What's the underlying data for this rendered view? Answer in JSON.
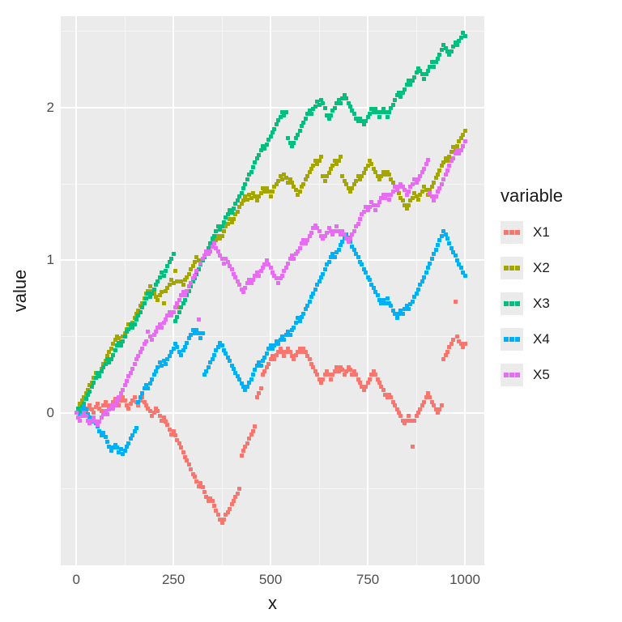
{
  "axis": {
    "x_title": "x",
    "y_title": "value"
  },
  "legend": {
    "title": "variable",
    "items": [
      {
        "label": "X1",
        "color": "#F8766D"
      },
      {
        "label": "X2",
        "color": "#A3A500"
      },
      {
        "label": "X3",
        "color": "#00BF7D"
      },
      {
        "label": "X4",
        "color": "#00B0F6"
      },
      {
        "label": "X5",
        "color": "#E76BF3"
      }
    ]
  },
  "x_ticks": [
    0,
    250,
    500,
    750,
    1000
  ],
  "y_ticks": [
    0,
    1,
    2
  ],
  "chart_data": {
    "type": "scatter",
    "xlabel": "x",
    "ylabel": "value",
    "xlim": [
      -40,
      1050
    ],
    "ylim": [
      -1.0,
      2.6
    ],
    "grid": true,
    "legend_position": "right",
    "x_step": 5,
    "series": [
      {
        "name": "X1",
        "color": "#F8766D",
        "values": [
          0.0,
          0.02,
          0.04,
          0.01,
          -0.02,
          0.0,
          0.03,
          0.05,
          0.02,
          0.0,
          0.04,
          0.06,
          0.03,
          0.01,
          0.05,
          0.07,
          0.05,
          0.02,
          0.04,
          0.07,
          0.09,
          0.07,
          0.05,
          0.08,
          0.1,
          0.08,
          0.05,
          0.03,
          0.06,
          0.08,
          0.1,
          0.07,
          0.05,
          0.08,
          0.1,
          0.07,
          0.05,
          0.03,
          0.01,
          -0.02,
          0.0,
          0.03,
          0.01,
          -0.02,
          -0.05,
          -0.03,
          -0.06,
          -0.08,
          -0.11,
          -0.14,
          -0.12,
          -0.15,
          -0.18,
          -0.2,
          -0.23,
          -0.26,
          -0.29,
          -0.31,
          -0.34,
          -0.37,
          -0.4,
          -0.42,
          -0.45,
          -0.48,
          -0.46,
          -0.49,
          -0.52,
          -0.55,
          -0.58,
          -0.56,
          -0.58,
          -0.61,
          -0.64,
          -0.67,
          -0.7,
          -0.72,
          -0.7,
          -0.67,
          -0.65,
          -0.63,
          -0.6,
          -0.58,
          -0.55,
          -0.53,
          -0.5,
          -0.28,
          -0.25,
          -0.22,
          -0.2,
          -0.17,
          -0.14,
          -0.12,
          -0.09,
          0.1,
          0.13,
          0.16,
          0.25,
          0.27,
          0.3,
          0.32,
          0.35,
          0.37,
          0.35,
          0.38,
          0.4,
          0.42,
          0.4,
          0.37,
          0.4,
          0.42,
          0.4,
          0.37,
          0.35,
          0.38,
          0.4,
          0.42,
          0.4,
          0.42,
          0.4,
          0.37,
          0.35,
          0.32,
          0.3,
          0.27,
          0.25,
          0.22,
          0.2,
          0.22,
          0.25,
          0.27,
          0.25,
          0.22,
          0.25,
          0.27,
          0.3,
          0.27,
          0.3,
          0.28,
          0.25,
          0.27,
          0.3,
          0.28,
          0.25,
          0.27,
          0.25,
          0.22,
          0.2,
          0.17,
          0.15,
          0.17,
          0.2,
          0.22,
          0.25,
          0.27,
          0.25,
          0.22,
          0.2,
          0.17,
          0.15,
          0.12,
          0.1,
          0.12,
          0.1,
          0.07,
          0.05,
          0.02,
          0.0,
          -0.02,
          -0.05,
          -0.07,
          -0.05,
          -0.02,
          -0.05,
          -0.22,
          -0.05,
          -0.02,
          0.0,
          0.02,
          0.05,
          0.07,
          0.1,
          0.13,
          0.1,
          0.07,
          0.05,
          0.02,
          0.0,
          0.02,
          0.05,
          0.35,
          0.38,
          0.4,
          0.43,
          0.45,
          0.48,
          0.73,
          0.5,
          0.47,
          0.45,
          0.43,
          0.45
        ]
      },
      {
        "name": "X2",
        "color": "#A3A500",
        "values": [
          0.0,
          0.03,
          0.06,
          0.08,
          0.1,
          0.13,
          0.15,
          0.18,
          0.2,
          0.23,
          0.26,
          0.24,
          0.26,
          0.29,
          0.32,
          0.34,
          0.37,
          0.4,
          0.42,
          0.45,
          0.48,
          0.5,
          0.49,
          0.47,
          0.5,
          0.52,
          0.55,
          0.58,
          0.56,
          0.59,
          0.62,
          0.65,
          0.67,
          0.7,
          0.72,
          0.75,
          0.78,
          0.8,
          0.83,
          0.8,
          0.78,
          0.76,
          0.74,
          0.77,
          0.79,
          0.72,
          0.8,
          0.82,
          0.84,
          0.87,
          0.85,
          0.93,
          0.86,
          0.69,
          0.86,
          0.84,
          0.87,
          0.89,
          0.91,
          0.94,
          0.96,
          0.99,
          1.02,
          1.0,
          0.97,
          1.0,
          1.02,
          1.05,
          1.07,
          1.1,
          1.12,
          1.15,
          1.13,
          1.16,
          1.14,
          1.16,
          1.19,
          1.22,
          1.24,
          1.27,
          1.25,
          1.27,
          1.3,
          1.32,
          1.35,
          1.37,
          1.39,
          1.42,
          1.4,
          1.43,
          1.41,
          1.44,
          1.42,
          1.39,
          1.42,
          1.44,
          1.47,
          1.45,
          1.47,
          1.45,
          1.42,
          1.45,
          1.48,
          1.5,
          1.52,
          1.55,
          1.53,
          1.56,
          1.54,
          1.51,
          1.53,
          1.51,
          1.48,
          1.46,
          1.43,
          1.45,
          1.48,
          1.5,
          1.53,
          1.55,
          1.58,
          1.6,
          1.62,
          1.65,
          1.63,
          1.65,
          1.68,
          1.55,
          1.52,
          1.55,
          1.57,
          1.6,
          1.62,
          1.65,
          1.63,
          1.65,
          1.68,
          1.55,
          1.52,
          1.5,
          1.47,
          1.45,
          1.47,
          1.5,
          1.52,
          1.55,
          1.53,
          1.55,
          1.57,
          1.6,
          1.62,
          1.65,
          1.63,
          1.6,
          1.58,
          1.55,
          1.53,
          1.55,
          1.58,
          1.56,
          1.58,
          1.56,
          1.53,
          1.51,
          1.48,
          1.46,
          1.44,
          1.41,
          1.39,
          1.36,
          1.34,
          1.36,
          1.39,
          1.41,
          1.44,
          1.42,
          1.4,
          1.43,
          1.45,
          1.48,
          1.46,
          1.43,
          1.46,
          1.48,
          1.51,
          1.54,
          1.56,
          1.59,
          1.62,
          1.64,
          1.67,
          1.65,
          1.68,
          1.71,
          1.74,
          1.72,
          1.75,
          1.78,
          1.8,
          1.82,
          1.85
        ]
      },
      {
        "name": "X3",
        "color": "#00BF7D",
        "values": [
          0.0,
          0.03,
          0.01,
          0.04,
          0.06,
          0.09,
          0.12,
          0.14,
          0.17,
          0.2,
          0.23,
          0.26,
          0.24,
          0.27,
          0.3,
          0.32,
          0.35,
          0.33,
          0.35,
          0.38,
          0.41,
          0.44,
          0.46,
          0.44,
          0.47,
          0.5,
          0.53,
          0.55,
          0.58,
          0.56,
          0.58,
          0.61,
          0.64,
          0.66,
          0.69,
          0.72,
          0.75,
          0.78,
          0.76,
          0.78,
          0.81,
          0.84,
          0.86,
          0.89,
          0.92,
          0.9,
          0.93,
          0.96,
          0.99,
          1.01,
          1.04,
          0.6,
          0.63,
          0.66,
          0.69,
          0.72,
          0.74,
          0.77,
          0.8,
          0.83,
          0.86,
          0.88,
          0.91,
          0.94,
          0.97,
          1.0,
          1.02,
          1.05,
          1.08,
          1.11,
          1.14,
          1.16,
          1.19,
          1.22,
          1.2,
          1.22,
          1.25,
          1.28,
          1.3,
          1.33,
          1.31,
          1.34,
          1.37,
          1.39,
          1.42,
          1.44,
          1.47,
          1.5,
          1.53,
          1.56,
          1.58,
          1.61,
          1.64,
          1.67,
          1.69,
          1.72,
          1.75,
          1.73,
          1.76,
          1.79,
          1.81,
          1.84,
          1.86,
          1.89,
          1.92,
          1.94,
          1.97,
          1.95,
          1.97,
          1.8,
          1.77,
          1.75,
          1.77,
          1.8,
          1.82,
          1.85,
          1.88,
          1.9,
          1.93,
          1.96,
          1.98,
          1.96,
          1.99,
          2.01,
          2.04,
          2.02,
          2.05,
          2.03,
          2.0,
          1.95,
          1.93,
          1.95,
          1.98,
          2.0,
          2.03,
          2.05,
          2.03,
          2.06,
          2.08,
          2.06,
          2.03,
          2.01,
          1.98,
          1.96,
          1.93,
          1.91,
          1.93,
          1.91,
          1.89,
          1.91,
          1.94,
          1.96,
          1.99,
          1.97,
          1.99,
          1.97,
          1.94,
          1.97,
          1.99,
          1.97,
          1.94,
          1.97,
          2.0,
          2.02,
          2.05,
          2.08,
          2.1,
          2.07,
          2.1,
          2.12,
          2.15,
          2.18,
          2.15,
          2.18,
          2.2,
          2.23,
          2.26,
          2.24,
          2.22,
          2.19,
          2.22,
          2.24,
          2.27,
          2.3,
          2.27,
          2.3,
          2.32,
          2.35,
          2.38,
          2.41,
          2.39,
          2.37,
          2.35,
          2.37,
          2.4,
          2.43,
          2.41,
          2.44,
          2.46,
          2.49,
          2.47
        ]
      },
      {
        "name": "X4",
        "color": "#00B0F6",
        "values": [
          0.0,
          -0.03,
          -0.01,
          0.02,
          0.04,
          0.02,
          -0.01,
          -0.03,
          -0.06,
          -0.04,
          -0.07,
          -0.09,
          -0.12,
          -0.15,
          -0.13,
          -0.16,
          -0.19,
          -0.22,
          -0.25,
          -0.23,
          -0.21,
          -0.23,
          -0.26,
          -0.24,
          -0.27,
          -0.25,
          -0.22,
          -0.2,
          -0.17,
          -0.15,
          -0.12,
          -0.1,
          0.07,
          0.1,
          0.13,
          0.16,
          0.18,
          0.16,
          0.19,
          0.22,
          0.25,
          0.27,
          0.3,
          0.33,
          0.31,
          0.34,
          0.32,
          0.35,
          0.37,
          0.4,
          0.42,
          0.45,
          0.43,
          0.4,
          0.38,
          0.41,
          0.43,
          0.46,
          0.49,
          0.51,
          0.54,
          0.52,
          0.54,
          0.52,
          0.49,
          0.52,
          0.25,
          0.27,
          0.3,
          0.33,
          0.35,
          0.38,
          0.41,
          0.43,
          0.46,
          0.44,
          0.41,
          0.39,
          0.36,
          0.34,
          0.31,
          0.29,
          0.26,
          0.24,
          0.22,
          0.19,
          0.17,
          0.15,
          0.17,
          0.2,
          0.22,
          0.25,
          0.28,
          0.31,
          0.33,
          0.31,
          0.34,
          0.36,
          0.39,
          0.42,
          0.44,
          0.42,
          0.44,
          0.47,
          0.45,
          0.48,
          0.5,
          0.48,
          0.51,
          0.53,
          0.51,
          0.54,
          0.56,
          0.59,
          0.62,
          0.6,
          0.63,
          0.65,
          0.68,
          0.7,
          0.73,
          0.76,
          0.78,
          0.81,
          0.84,
          0.86,
          0.89,
          0.91,
          0.94,
          0.97,
          0.99,
          1.02,
          1.04,
          1.02,
          1.05,
          1.07,
          1.1,
          1.12,
          1.15,
          1.17,
          1.15,
          1.12,
          1.09,
          1.07,
          1.04,
          1.02,
          0.99,
          0.97,
          0.94,
          0.92,
          0.89,
          0.87,
          0.84,
          0.82,
          0.79,
          0.77,
          0.74,
          0.72,
          0.74,
          0.72,
          0.75,
          0.72,
          0.7,
          0.67,
          0.65,
          0.62,
          0.65,
          0.67,
          0.65,
          0.68,
          0.7,
          0.68,
          0.71,
          0.73,
          0.76,
          0.78,
          0.81,
          0.84,
          0.86,
          0.89,
          0.92,
          0.95,
          0.98,
          1.01,
          1.04,
          1.07,
          1.1,
          1.13,
          1.16,
          1.19,
          1.17,
          1.14,
          1.11,
          1.08,
          1.05,
          1.03,
          1.0,
          0.97,
          0.95,
          0.92,
          0.9
        ]
      },
      {
        "name": "X5",
        "color": "#E76BF3",
        "values": [
          0.0,
          -0.03,
          -0.05,
          -0.02,
          0.0,
          -0.02,
          -0.05,
          -0.07,
          -0.05,
          -0.03,
          -0.06,
          -0.08,
          -0.06,
          -0.03,
          -0.01,
          0.01,
          -0.01,
          0.02,
          0.05,
          0.03,
          0.05,
          0.08,
          0.1,
          0.13,
          0.15,
          0.18,
          0.21,
          0.24,
          0.26,
          0.29,
          0.32,
          0.35,
          0.37,
          0.4,
          0.42,
          0.45,
          0.47,
          0.53,
          0.5,
          0.48,
          0.51,
          0.53,
          0.56,
          0.58,
          0.56,
          0.59,
          0.61,
          0.64,
          0.66,
          0.64,
          0.66,
          0.69,
          0.72,
          0.74,
          0.77,
          0.79,
          0.77,
          0.8,
          0.83,
          0.85,
          0.88,
          0.9,
          0.93,
          0.61,
          0.98,
          1.01,
          1.03,
          1.06,
          1.04,
          1.06,
          1.09,
          1.11,
          1.08,
          1.06,
          1.03,
          1.01,
          0.98,
          1.01,
          0.99,
          0.96,
          0.94,
          0.91,
          0.89,
          0.86,
          0.84,
          0.81,
          0.79,
          0.82,
          0.85,
          0.87,
          0.85,
          0.87,
          0.9,
          0.92,
          0.9,
          0.93,
          0.95,
          0.97,
          1.0,
          0.97,
          0.95,
          0.92,
          0.9,
          0.88,
          0.85,
          0.88,
          0.9,
          0.93,
          0.95,
          0.98,
          1.01,
          1.03,
          1.01,
          1.04,
          1.06,
          1.08,
          1.11,
          1.13,
          1.11,
          1.13,
          1.16,
          1.18,
          1.21,
          1.23,
          1.21,
          1.19,
          1.16,
          1.14,
          1.16,
          1.18,
          1.21,
          1.19,
          1.17,
          1.19,
          1.22,
          1.19,
          1.17,
          1.19,
          1.17,
          1.14,
          1.12,
          1.14,
          1.17,
          1.19,
          1.22,
          1.24,
          1.27,
          1.3,
          1.32,
          1.35,
          1.33,
          1.35,
          1.38,
          1.36,
          1.33,
          1.36,
          1.38,
          1.41,
          1.43,
          1.41,
          1.43,
          1.4,
          1.43,
          1.45,
          1.48,
          1.46,
          1.48,
          1.5,
          1.48,
          1.46,
          1.43,
          1.45,
          1.48,
          1.5,
          1.53,
          1.51,
          1.53,
          1.55,
          1.58,
          1.6,
          1.63,
          1.66,
          1.44,
          1.42,
          1.39,
          1.42,
          1.45,
          1.47,
          1.5,
          1.53,
          1.56,
          1.59,
          1.62,
          1.65,
          1.67,
          1.7,
          1.72,
          1.7,
          1.72,
          1.75,
          1.78
        ]
      }
    ]
  }
}
